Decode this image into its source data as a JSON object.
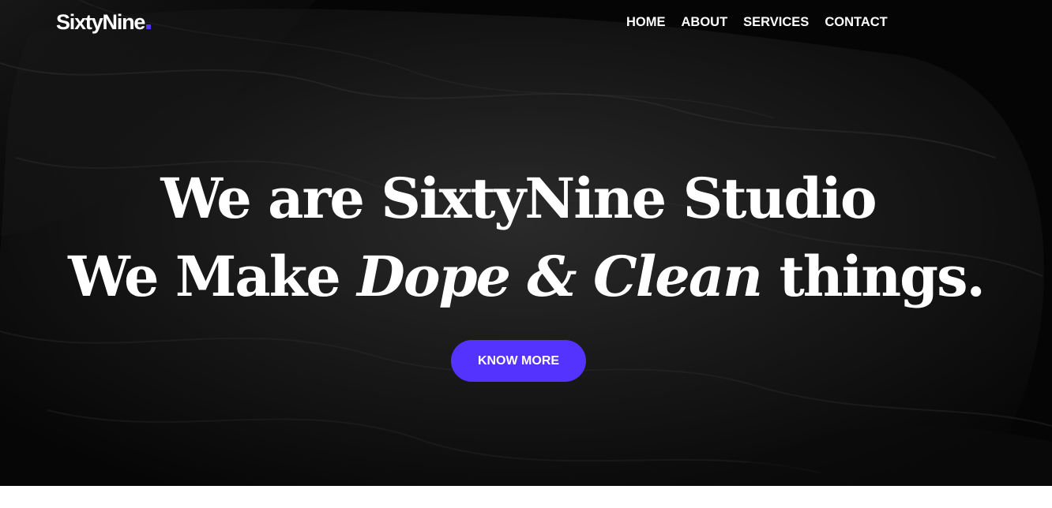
{
  "brand": {
    "name": "SixtyNine",
    "accent_color": "#5533ff"
  },
  "nav": {
    "items": [
      "HOME",
      "ABOUT",
      "SERVICES",
      "CONTACT"
    ]
  },
  "hero": {
    "line1": "We are SixtyNine Studio",
    "line2_prefix": "We Make ",
    "line2_emphasis": "Dope & Clean",
    "line2_suffix": " things.",
    "cta_label": "KNOW MORE",
    "background_color": "#050505"
  }
}
